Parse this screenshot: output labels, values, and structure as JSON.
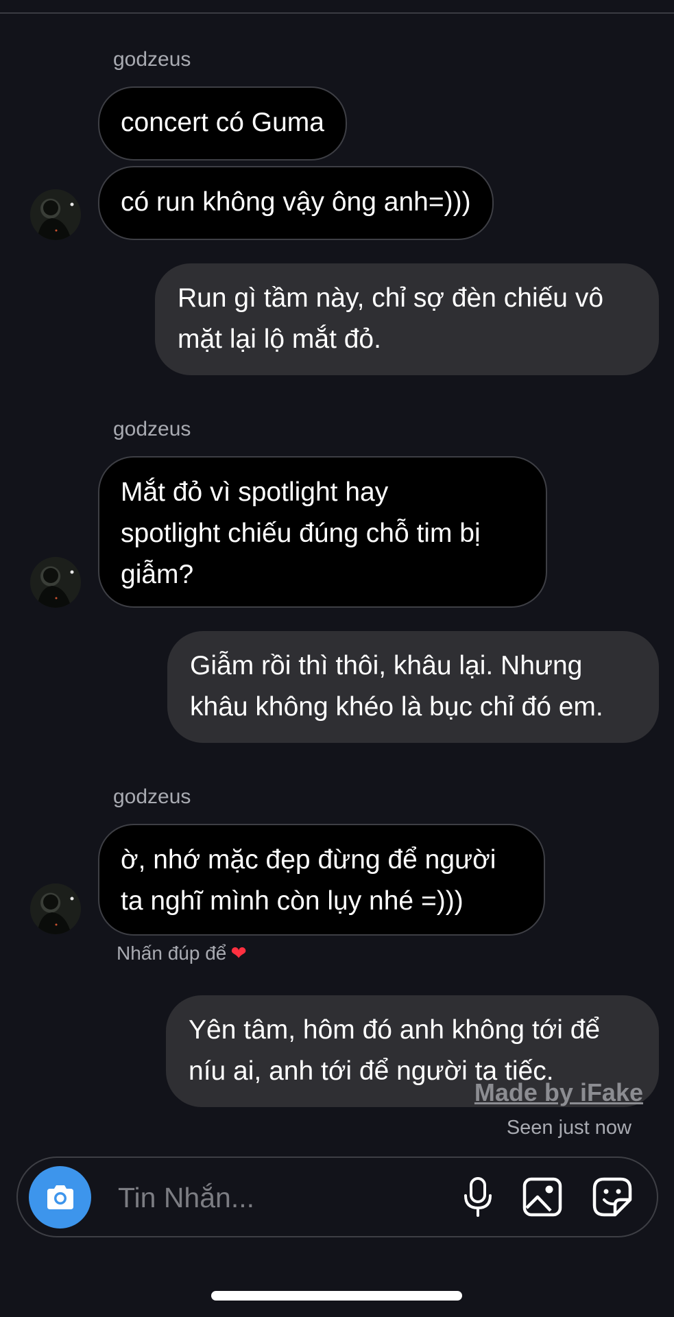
{
  "conversation": {
    "groups": [
      {
        "sender": "godzeus",
        "incoming": [
          "concert có Guma",
          "có run không vậy ông anh=)))"
        ],
        "outgoing": "Run gì tầm này, chỉ sợ đèn chiếu vô\nmặt lại lộ mắt đỏ."
      },
      {
        "sender": "godzeus",
        "incoming": [
          "Mắt đỏ vì spotlight hay\nspotlight chiếu đúng chỗ tim bị\ngiẫm?"
        ],
        "outgoing": "Giẫm rồi thì thôi, khâu lại. Nhưng\nkhâu không khéo là bục chỉ đó em."
      },
      {
        "sender": "godzeus",
        "incoming": [
          "ờ, nhớ mặc đẹp đừng để người\nta nghĩ mình còn lụy nhé =)))"
        ],
        "hint": "Nhấn đúp để",
        "hint_icon": "heart-icon",
        "outgoing": "Yên tâm, hôm đó anh không tới để\nníu ai, anh tới để người ta tiếc."
      }
    ],
    "watermark": "Made by iFake",
    "seen_status": "Seen just now"
  },
  "composer": {
    "placeholder": "Tin Nhắn...",
    "icons": [
      "camera-icon",
      "microphone-icon",
      "gallery-icon",
      "sticker-icon"
    ]
  },
  "colors": {
    "background": "#12131a",
    "incoming_bubble": "#000000",
    "outgoing_bubble": "#2f2f33",
    "camera_button": "#3d95ec",
    "heart": "#ff3040"
  }
}
